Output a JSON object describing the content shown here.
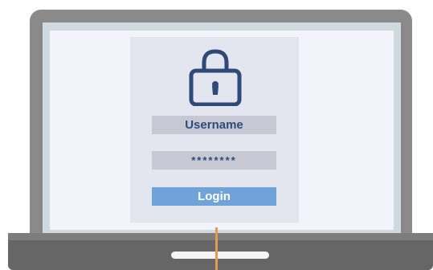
{
  "login_form": {
    "lock_icon": "padlock-icon",
    "username_label": "Username",
    "password_value": "********",
    "login_label": "Login"
  },
  "colors": {
    "accent": "#6fa3d9",
    "text": "#2f4a78",
    "cursor": "#e39a55"
  }
}
